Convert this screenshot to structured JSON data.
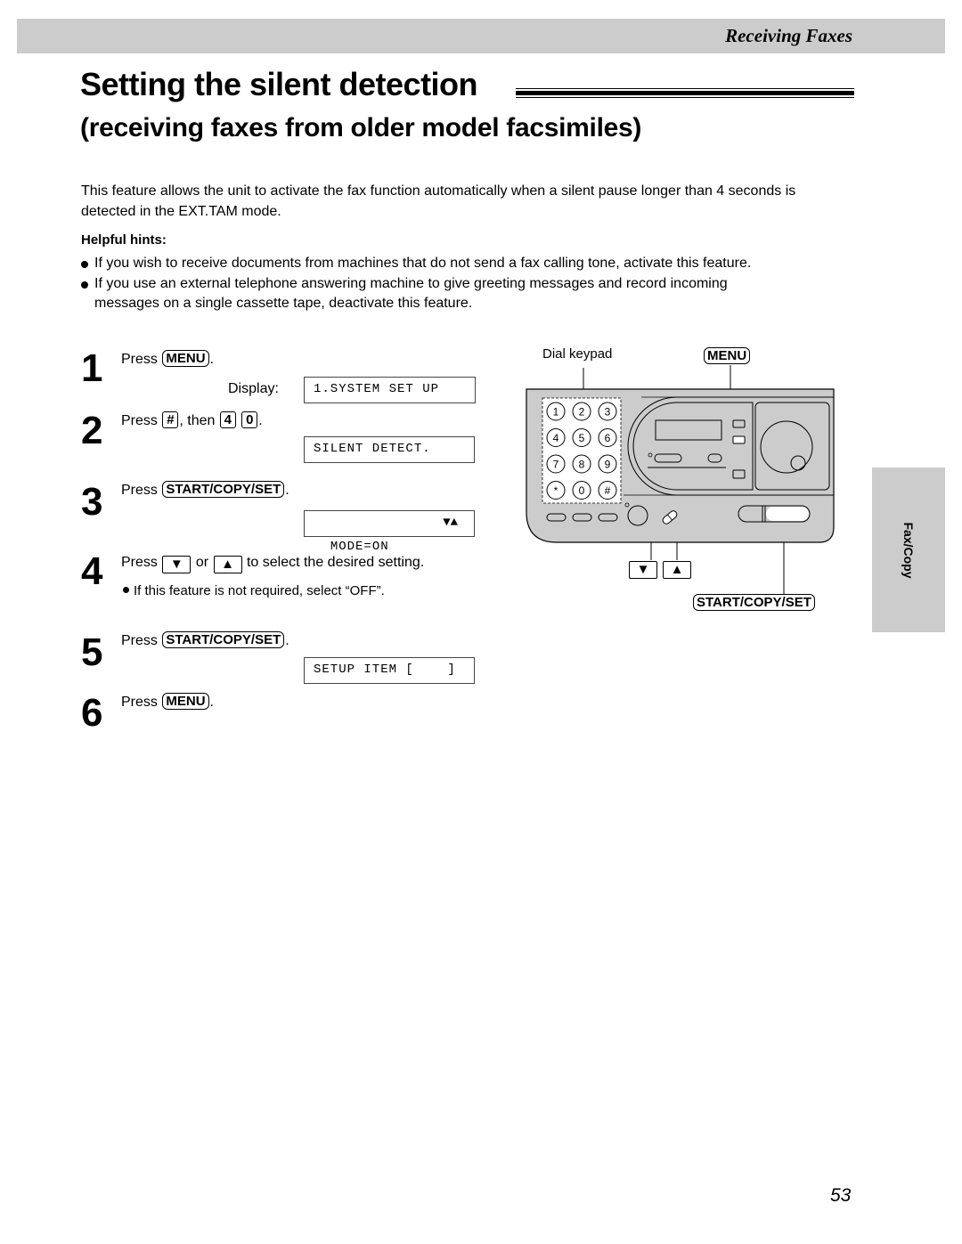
{
  "header": {
    "section_name": "Receiving Faxes"
  },
  "page": {
    "title": "Setting the silent detection",
    "subtitle": "(receiving faxes from older model facsimiles)",
    "intro": "This feature allows the unit to activate the fax function automatically when a silent pause longer than 4 seconds is detected in the EXT.TAM mode.",
    "hints_heading": "Helpful hints:",
    "hints": [
      "If you wish to receive documents from machines that do not send a fax calling tone, activate this feature.",
      "If you use an external telephone answering machine to give greeting messages and record incoming messages on a single cassette tape, deactivate this feature."
    ],
    "page_number": "53"
  },
  "steps": [
    {
      "number": "1",
      "press": "Press",
      "key": "MENU",
      "after": ".",
      "display_label": "Display:",
      "display": "1.SYSTEM SET UP"
    },
    {
      "number": "2",
      "press": "Press",
      "key": "#",
      "then": ", then",
      "key2": "4",
      "key3": "0",
      "after": ".",
      "display": "SILENT DETECT."
    },
    {
      "number": "3",
      "press": "Press",
      "key": "START/COPY/SET",
      "after": ".",
      "display": "MODE=ON",
      "display_arrows": "▼▲"
    },
    {
      "number": "4",
      "press": "Press",
      "key": "▼",
      "or": "or",
      "key2": "▲",
      "after": "to select the desired setting.",
      "note": "If this feature is not required, select “OFF”."
    },
    {
      "number": "5",
      "press": "Press",
      "key": "START/COPY/SET",
      "after": ".",
      "display": "SETUP ITEM [    ]"
    },
    {
      "number": "6",
      "press": "Press",
      "key": "MENU",
      "after": "."
    }
  ],
  "device": {
    "dial_keypad_label": "Dial keypad",
    "menu_label": "MENU",
    "start_copy_set_label": "START/COPY/SET",
    "down_label": "▼",
    "up_label": "▲",
    "keypad_keys": [
      "1",
      "2",
      "3",
      "4",
      "5",
      "6",
      "7",
      "8",
      "9",
      "*",
      "0",
      "#"
    ]
  },
  "side_tab": {
    "label": "Fax/Copy"
  }
}
